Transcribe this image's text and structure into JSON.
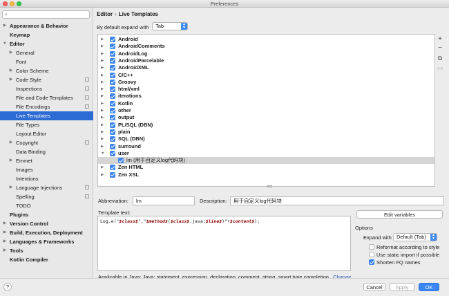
{
  "window": {
    "title": "Preferences"
  },
  "search": {
    "placeholder": ""
  },
  "sidebar": {
    "items": [
      {
        "label": "Appearance & Behavior",
        "arrow": "▶",
        "bold": true
      },
      {
        "label": "Keymap",
        "arrow": "",
        "bold": true
      },
      {
        "label": "Editor",
        "arrow": "▼",
        "bold": true
      },
      {
        "label": "General",
        "arrow": "▶",
        "bold": false
      },
      {
        "label": "Font",
        "arrow": "",
        "bold": false
      },
      {
        "label": "Color Scheme",
        "arrow": "▶",
        "bold": false
      },
      {
        "label": "Code Style",
        "arrow": "▶",
        "bold": false
      },
      {
        "label": "Inspections",
        "arrow": "",
        "bold": false
      },
      {
        "label": "File and Code Templates",
        "arrow": "",
        "bold": false
      },
      {
        "label": "File Encodings",
        "arrow": "",
        "bold": false
      },
      {
        "label": "Live Templates",
        "arrow": "",
        "bold": false
      },
      {
        "label": "File Types",
        "arrow": "",
        "bold": false
      },
      {
        "label": "Layout Editor",
        "arrow": "",
        "bold": false
      },
      {
        "label": "Copyright",
        "arrow": "▶",
        "bold": false
      },
      {
        "label": "Data Binding",
        "arrow": "",
        "bold": false
      },
      {
        "label": "Emmet",
        "arrow": "▶",
        "bold": false
      },
      {
        "label": "Images",
        "arrow": "",
        "bold": false
      },
      {
        "label": "Intentions",
        "arrow": "",
        "bold": false
      },
      {
        "label": "Language Injections",
        "arrow": "▶",
        "bold": false
      },
      {
        "label": "Spelling",
        "arrow": "",
        "bold": false
      },
      {
        "label": "TODO",
        "arrow": "",
        "bold": false
      },
      {
        "label": "Plugins",
        "arrow": "",
        "bold": true
      },
      {
        "label": "Version Control",
        "arrow": "▶",
        "bold": true
      },
      {
        "label": "Build, Execution, Deployment",
        "arrow": "▶",
        "bold": true
      },
      {
        "label": "Languages & Frameworks",
        "arrow": "▶",
        "bold": true
      },
      {
        "label": "Tools",
        "arrow": "▶",
        "bold": true
      },
      {
        "label": "Kotlin Compiler",
        "arrow": "",
        "bold": true
      }
    ]
  },
  "breadcrumb": {
    "parent": "Editor",
    "separator": "›",
    "current": "Live Templates"
  },
  "expand": {
    "label": "By default expand with",
    "value": "Tab"
  },
  "templates": [
    {
      "name": "Android",
      "arrow": "▶"
    },
    {
      "name": "AndroidComments",
      "arrow": "▶"
    },
    {
      "name": "AndroidLog",
      "arrow": "▶"
    },
    {
      "name": "AndroidParcelable",
      "arrow": "▶"
    },
    {
      "name": "AndroidXML",
      "arrow": "▶"
    },
    {
      "name": "C/C++",
      "arrow": "▶"
    },
    {
      "name": "Groovy",
      "arrow": "▶"
    },
    {
      "name": "html/xml",
      "arrow": "▶"
    },
    {
      "name": "iterations",
      "arrow": "▶"
    },
    {
      "name": "Kotlin",
      "arrow": "▶"
    },
    {
      "name": "other",
      "arrow": "▶"
    },
    {
      "name": "output",
      "arrow": "▶"
    },
    {
      "name": "PL/SQL (DBN)",
      "arrow": "▶"
    },
    {
      "name": "plain",
      "arrow": "▶"
    },
    {
      "name": "SQL (DBN)",
      "arrow": "▶"
    },
    {
      "name": "surround",
      "arrow": "▶"
    },
    {
      "name": "user",
      "arrow": "▼"
    },
    {
      "name": "lm (用于自定义log代码块)",
      "arrow": ""
    },
    {
      "name": "Zen HTML",
      "arrow": "▶"
    },
    {
      "name": "Zen XSL",
      "arrow": "▶"
    }
  ],
  "tools": {
    "add": "+",
    "remove": "−",
    "copy": "⧉",
    "restore": "▭"
  },
  "abbreviation": {
    "label": "Abbreviation:",
    "value": "lm"
  },
  "description": {
    "label": "Description:",
    "value": "用于自定义log代码块"
  },
  "template_text": {
    "label": "Template text:",
    "parts": [
      {
        "t": "Log.e(\"",
        "v": false
      },
      {
        "t": "$class$",
        "v": true
      },
      {
        "t": "\",\"",
        "v": false
      },
      {
        "t": "$method$",
        "v": true
      },
      {
        "t": "(",
        "v": false
      },
      {
        "t": "$class$",
        "v": true
      },
      {
        "t": ".java:",
        "v": false
      },
      {
        "t": "$line$",
        "v": true
      },
      {
        "t": ")\"+",
        "v": false
      },
      {
        "t": "$content$",
        "v": true
      },
      {
        "t": ");",
        "v": false
      }
    ]
  },
  "edit_variables": "Edit variables",
  "options": {
    "title": "Options",
    "expand_label": "Expand with",
    "expand_value": "Default (Tab)",
    "reformat": "Reformat according to style",
    "static_import": "Use static import if possible",
    "shorten_fq": "Shorten FQ names"
  },
  "applicable": {
    "text": "Applicable in Java; Java: statement, expression, declaration, comment, string, smart type completion...",
    "change": "Change"
  },
  "footer": {
    "help": "?",
    "cancel": "Cancel",
    "apply": "Apply",
    "ok": "OK"
  },
  "colors": {
    "accent": "#3a86f4",
    "selection": "#2d6bd4",
    "variable": "#8b0000"
  }
}
